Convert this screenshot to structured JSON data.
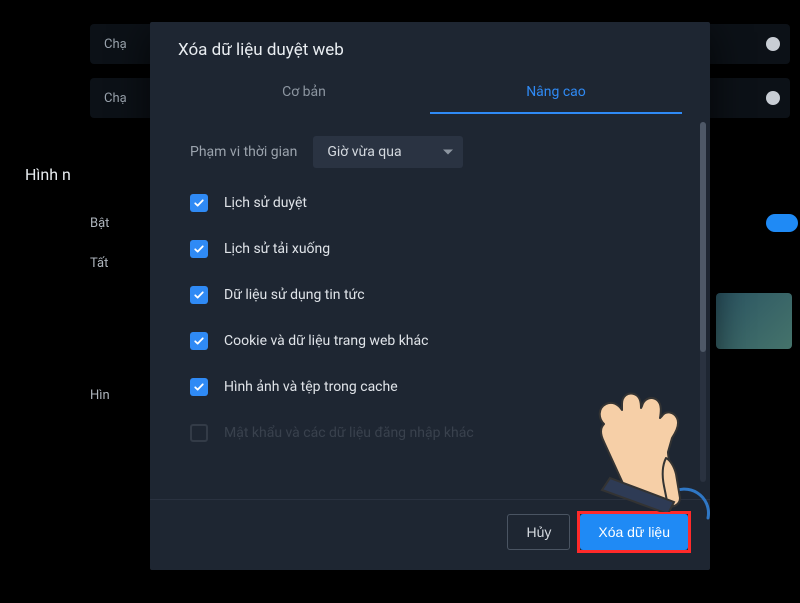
{
  "background": {
    "row1": "Chạ",
    "row2": "Chạ",
    "section_title": "Hình n",
    "label_on": "Bật",
    "label_all": "Tất",
    "label_img": "Hìn"
  },
  "modal": {
    "title": "Xóa dữ liệu duyệt web",
    "tabs": {
      "basic": "Cơ bản",
      "advanced": "Nâng cao"
    },
    "time_range_label": "Phạm vi thời gian",
    "time_range_value": "Giờ vừa qua",
    "items": [
      {
        "label": "Lịch sử duyệt",
        "checked": true
      },
      {
        "label": "Lịch sử tải xuống",
        "checked": true
      },
      {
        "label": "Dữ liệu sử dụng tin tức",
        "checked": true
      },
      {
        "label": "Cookie và dữ liệu trang web khác",
        "checked": true
      },
      {
        "label": "Hình ảnh và tệp trong cache",
        "checked": true
      },
      {
        "label": "Mật khẩu và các dữ liệu đăng nhập khác",
        "checked": false
      }
    ],
    "buttons": {
      "cancel": "Hủy",
      "clear": "Xóa dữ liệu"
    }
  },
  "annotation": {
    "highlight_color": "#ff2a2a",
    "pointer_icon": "hand-pointer-icon"
  }
}
